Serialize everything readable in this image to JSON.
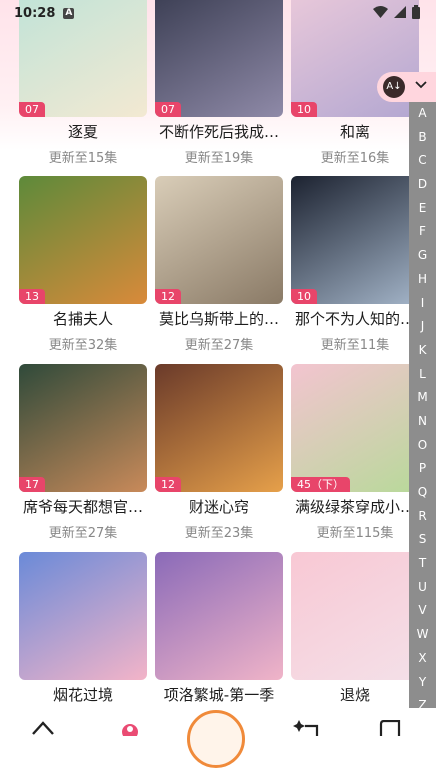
{
  "status_bar": {
    "time": "10:28",
    "notification_icon": "a-icon"
  },
  "sort_button": {
    "icon": "sort-az-icon"
  },
  "alphabet_index": [
    "A",
    "B",
    "C",
    "D",
    "E",
    "F",
    "G",
    "H",
    "I",
    "J",
    "K",
    "L",
    "M",
    "N",
    "O",
    "P",
    "Q",
    "R",
    "S",
    "T",
    "U",
    "V",
    "W",
    "X",
    "Y",
    "Z"
  ],
  "items": [
    {
      "title": "逐夏",
      "episodes": "更新至15集",
      "badge": "07",
      "colors": [
        "#bfe3d8",
        "#f3e9d2"
      ]
    },
    {
      "title": "不断作死后我成…",
      "episodes": "更新至19集",
      "badge": "07",
      "colors": [
        "#3a3d52",
        "#8f8aa8"
      ]
    },
    {
      "title": "和离",
      "episodes": "更新至16集",
      "badge": "10",
      "colors": [
        "#eac9da",
        "#b3a7d1"
      ]
    },
    {
      "title": "名捕夫人",
      "episodes": "更新至32集",
      "badge": "13",
      "colors": [
        "#5d8a3a",
        "#d98a3a"
      ]
    },
    {
      "title": "莫比乌斯带上的…",
      "episodes": "更新至27集",
      "badge": "12",
      "colors": [
        "#d9cdb8",
        "#8a7a66"
      ]
    },
    {
      "title": "那个不为人知的…",
      "episodes": "更新至11集",
      "badge": "10",
      "colors": [
        "#1c2230",
        "#a3b4c8"
      ]
    },
    {
      "title": "席爷每天都想官…",
      "episodes": "更新至27集",
      "badge": "17",
      "colors": [
        "#2f4a3a",
        "#c98a5a"
      ]
    },
    {
      "title": "财迷心窍",
      "episodes": "更新至23集",
      "badge": "12",
      "colors": [
        "#6a3a2a",
        "#e6a04a"
      ]
    },
    {
      "title": "满级绿茶穿成小…",
      "episodes": "更新至115集",
      "badge": "45（下）",
      "colors": [
        "#f3c4d0",
        "#b8d99a"
      ]
    },
    {
      "title": "烟花过境",
      "episodes": "",
      "badge": "",
      "colors": [
        "#6a8ad8",
        "#f3b4c8"
      ]
    },
    {
      "title": "项洛繁城-第一季",
      "episodes": "",
      "badge": "",
      "colors": [
        "#8a6ab8",
        "#f0b4c8"
      ]
    },
    {
      "title": "退烧",
      "episodes": "",
      "badge": "",
      "colors": [
        "#f8c8d4",
        "#f4e0e8"
      ]
    }
  ],
  "bottom_nav": [
    {
      "name": "home",
      "icon": "home-icon"
    },
    {
      "name": "flower",
      "icon": "flower-icon"
    },
    {
      "name": "center",
      "icon": "mascot-avatar-icon"
    },
    {
      "name": "sparkle",
      "icon": "sparkle-tag-icon"
    },
    {
      "name": "library",
      "icon": "book-icon"
    }
  ]
}
